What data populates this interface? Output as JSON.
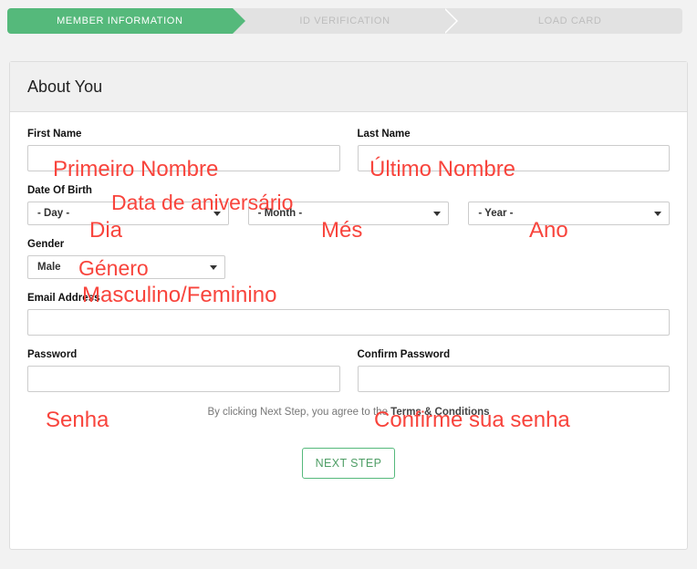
{
  "wizard": {
    "steps": [
      {
        "label": "MEMBER INFORMATION",
        "state": "active"
      },
      {
        "label": "ID VERIFICATION",
        "state": "inactive"
      },
      {
        "label": "LOAD CARD",
        "state": "inactive"
      }
    ]
  },
  "panel": {
    "title": "About You"
  },
  "form": {
    "first_name": {
      "label": "First Name",
      "value": "",
      "placeholder": ""
    },
    "last_name": {
      "label": "Last Name",
      "value": "",
      "placeholder": ""
    },
    "date_of_birth": {
      "label": "Date Of Birth",
      "day": {
        "selected": "- Day -",
        "caret": "chevron-down-icon"
      },
      "month": {
        "selected": "- Month -",
        "caret": "chevron-down-icon"
      },
      "year": {
        "selected": "- Year -",
        "caret": "chevron-down-icon"
      }
    },
    "gender": {
      "label": "Gender",
      "selected": "Male",
      "caret": "chevron-down-icon"
    },
    "email": {
      "label": "Email Address",
      "value": "",
      "placeholder": ""
    },
    "password": {
      "label": "Password",
      "value": "",
      "placeholder": ""
    },
    "confirm_password": {
      "label": "Confirm Password",
      "value": "",
      "placeholder": ""
    }
  },
  "terms": {
    "prefix": "By clicking Next Step, you agree to the ",
    "link": "Terms & Conditions"
  },
  "actions": {
    "next_step": "NEXT STEP"
  },
  "annotations": [
    {
      "text": "Primeiro Nombre",
      "for": "first-name"
    },
    {
      "text": "Último Nombre",
      "for": "last-name"
    },
    {
      "text": "Data de aniversário",
      "for": "date-of-birth-label"
    },
    {
      "text": "Dia",
      "for": "day-select"
    },
    {
      "text": "Més",
      "for": "month-select"
    },
    {
      "text": "Ano",
      "for": "year-select"
    },
    {
      "text": "Género",
      "for": "gender-label"
    },
    {
      "text": "Masculino/Feminino",
      "for": "gender-select"
    },
    {
      "text": "Senha",
      "for": "password"
    },
    {
      "text": "Confirme sua senha",
      "for": "confirm-password"
    }
  ],
  "colors": {
    "accent_green": "#55b97b",
    "annotation_red": "#f8443c",
    "page_background": "#f2f2f2",
    "inactive_step": "#e2e2e2"
  }
}
